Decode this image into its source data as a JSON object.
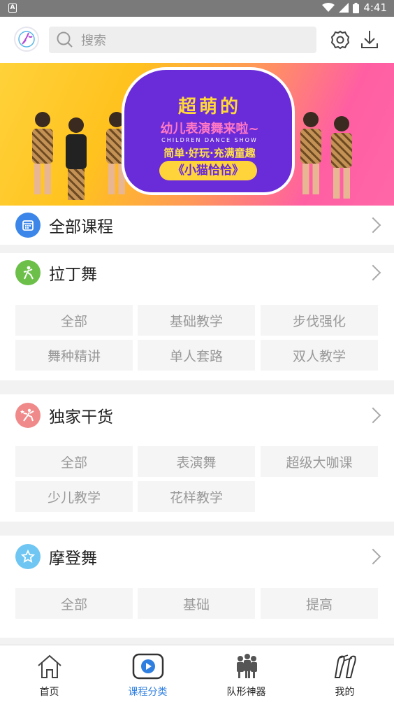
{
  "status_bar": {
    "time": "4:41"
  },
  "header": {
    "search_placeholder": "搜索"
  },
  "banner": {
    "title": "超萌的",
    "subtitle": "幼儿表演舞来啦~",
    "english": "CHILDREN DANCE SHOW",
    "slogan": "简单·好玩·充满童趣",
    "tag": "《小猫恰恰》"
  },
  "sections": [
    {
      "title": "全部课程",
      "icon": "calendar-icon",
      "color": "#3b86e8",
      "chips": []
    },
    {
      "title": "拉丁舞",
      "icon": "dancer-icon",
      "color": "#6cc04a",
      "chips": [
        "全部",
        "基础教学",
        "步伐强化",
        "舞种精讲",
        "单人套路",
        "双人教学"
      ]
    },
    {
      "title": "独家干货",
      "icon": "star-dancer-icon",
      "color": "#f08a8a",
      "chips": [
        "全部",
        "表演舞",
        "超级大咖课",
        "少儿教学",
        "花样教学"
      ]
    },
    {
      "title": "摩登舞",
      "icon": "star-icon",
      "color": "#6fc6f2",
      "chips": [
        "全部",
        "基础",
        "提高"
      ]
    }
  ],
  "bottom_nav": [
    {
      "label": "首页",
      "icon": "home-icon",
      "active": false
    },
    {
      "label": "课程分类",
      "icon": "play-icon",
      "active": true
    },
    {
      "label": "队形神器",
      "icon": "group-icon",
      "active": false
    },
    {
      "label": "我的",
      "icon": "shoes-icon",
      "active": false
    }
  ],
  "colors": {
    "accent": "#2f7fe0",
    "chip_bg": "#f5f5f5"
  }
}
